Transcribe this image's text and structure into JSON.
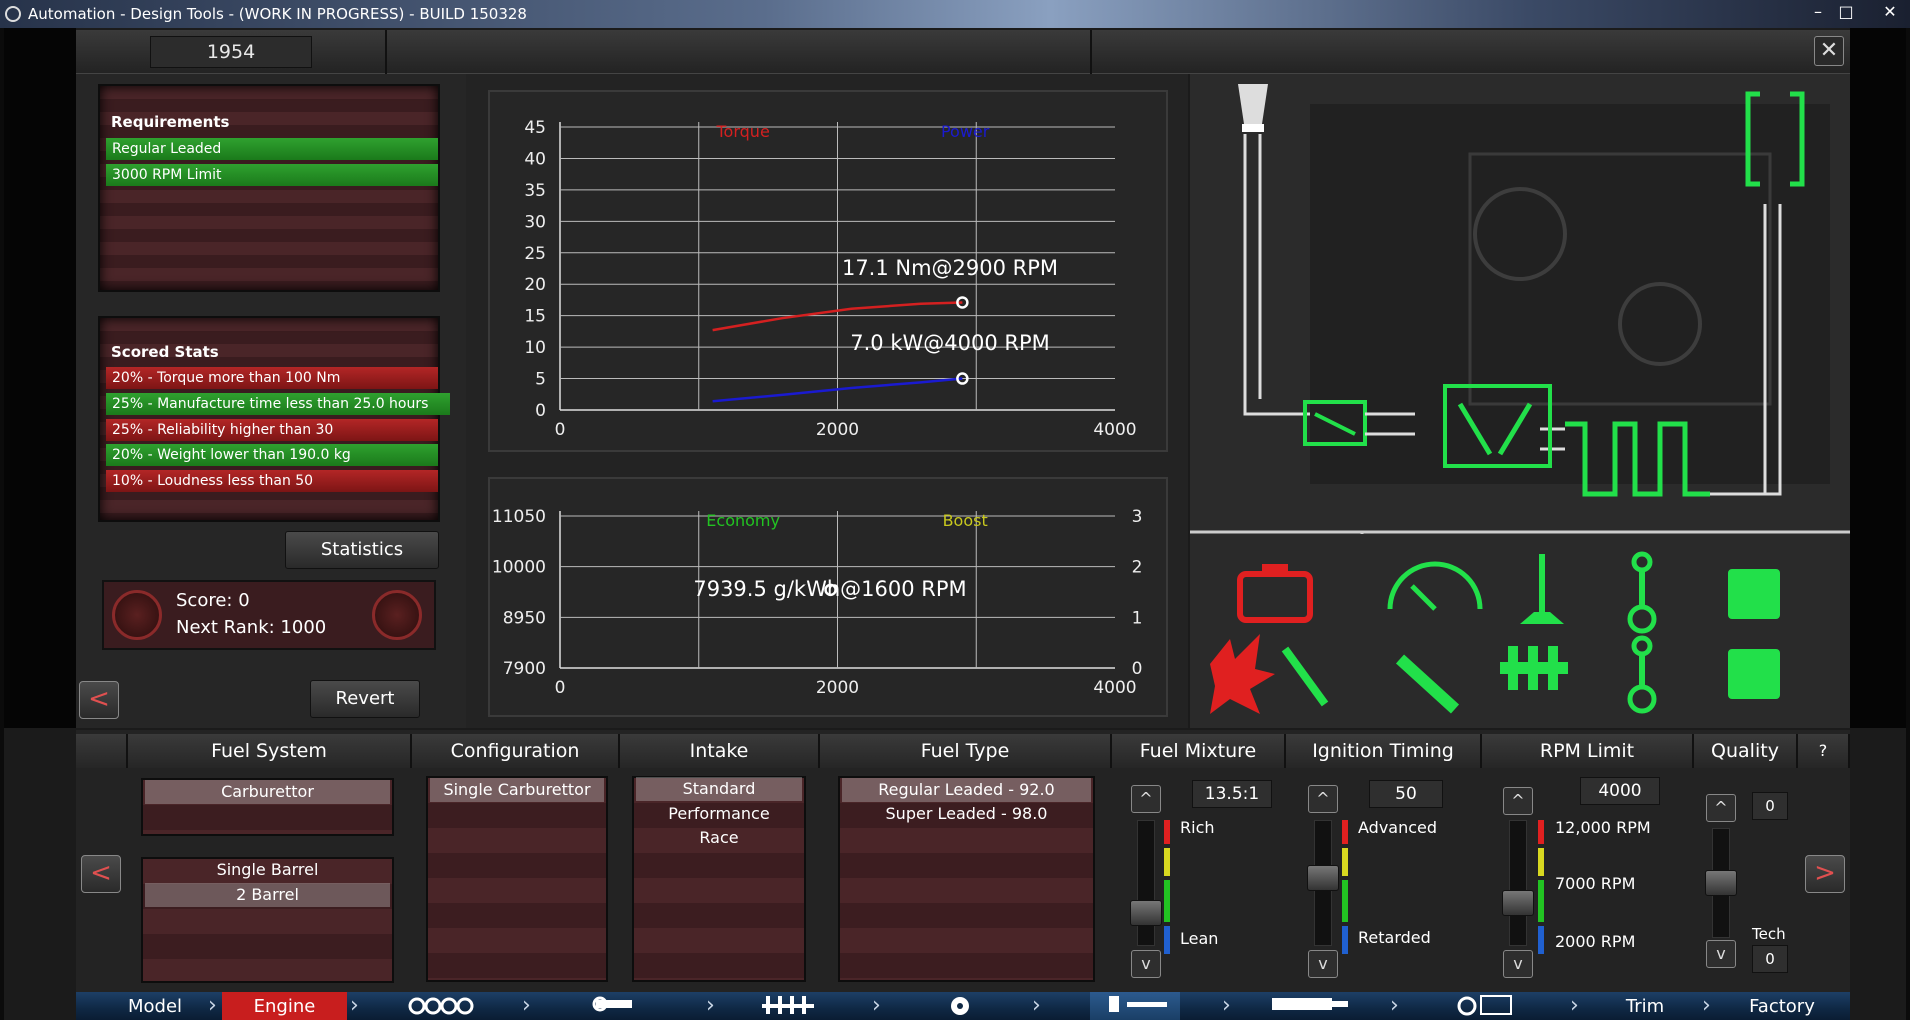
{
  "window": {
    "title": "Automation - Design Tools - (WORK IN PROGRESS) - BUILD 150328"
  },
  "header": {
    "year": "1954",
    "close_label": "✕"
  },
  "requirements": {
    "title": "Requirements",
    "items": [
      "Regular Leaded",
      "3000 RPM Limit"
    ]
  },
  "scored_stats": {
    "title": "Scored Stats",
    "items": [
      {
        "label": "20% - Torque more than 100 Nm",
        "status": "red"
      },
      {
        "label": "25% - Manufacture time less than 25.0 hours",
        "status": "green"
      },
      {
        "label": "25% - Reliability higher than 30",
        "status": "red"
      },
      {
        "label": "20% - Weight lower than 190.0 kg",
        "status": "green"
      },
      {
        "label": "10% - Loudness less than 50",
        "status": "red"
      }
    ]
  },
  "buttons": {
    "statistics": "Statistics",
    "revert": "Revert",
    "prev": "<",
    "next": ">"
  },
  "score": {
    "score_label": "Score: 0",
    "next_rank_label": "Next Rank: 1000"
  },
  "chart_data": [
    {
      "type": "line",
      "series": [
        {
          "name": "Torque",
          "color": "#d42020",
          "x": [
            1100,
            1600,
            2100,
            2600,
            2900
          ],
          "y": [
            12.7,
            14.6,
            16.1,
            16.9,
            17.1
          ]
        },
        {
          "name": "Power",
          "color": "#1a1ad0",
          "x": [
            1100,
            1600,
            2100,
            2600,
            2900
          ],
          "y": [
            1.4,
            2.4,
            3.5,
            4.4,
            5.0
          ]
        }
      ],
      "annotations": [
        "17.1 Nm@2900 RPM",
        "7.0 kW@4000 RPM"
      ],
      "xlim": [
        0,
        4000
      ],
      "ylim": [
        0,
        45
      ],
      "xticks": [
        "0",
        "2000",
        "4000"
      ],
      "yticks": [
        "0",
        "5",
        "10",
        "15",
        "20",
        "25",
        "30",
        "35",
        "40",
        "45"
      ],
      "grid": true,
      "legend": "top"
    },
    {
      "type": "line",
      "series": [
        {
          "name": "Economy",
          "color": "#22c322",
          "x": [
            1950
          ],
          "y": [
            9520
          ]
        },
        {
          "name": "Boost",
          "color": "#c8c81e",
          "x": [],
          "y": []
        }
      ],
      "annotations": [
        "7939.5 g/kWh@1600 RPM"
      ],
      "xlim": [
        0,
        4000
      ],
      "ylim": [
        7900,
        11050
      ],
      "y2lim": [
        0,
        3
      ],
      "xticks": [
        "0",
        "2000",
        "4000"
      ],
      "yticks": [
        "7900",
        "8950",
        "10000",
        "11050"
      ],
      "y2ticks": [
        "0",
        "1",
        "2",
        "3"
      ],
      "grid": true,
      "legend": "top"
    }
  ],
  "engine_icons": [
    "engine-warning-icon",
    "explosion-icon",
    "spark-plug-icon",
    "gauge-icon",
    "valve-icon",
    "conrod-icon",
    "piston-icon",
    "wrench-icon",
    "crankshaft-icon"
  ],
  "columns": {
    "fuel_system": "Fuel System",
    "configuration": "Configuration",
    "intake": "Intake",
    "fuel_type": "Fuel Type",
    "fuel_mixture": "Fuel Mixture",
    "ignition_timing": "Ignition Timing",
    "rpm_limit": "RPM Limit",
    "quality": "Quality",
    "help": "?"
  },
  "fuel_system": {
    "top": [
      "Carburettor"
    ],
    "bottom": [
      "Single Barrel",
      "2 Barrel"
    ]
  },
  "configuration": {
    "items": [
      "Single Carburettor"
    ]
  },
  "intake": {
    "items": [
      "Standard",
      "Performance",
      "Race"
    ]
  },
  "fuel_type": {
    "items": [
      "Regular Leaded - 92.0",
      "Super Leaded - 98.0"
    ]
  },
  "fuel_mixture": {
    "value": "13.5:1",
    "top_label": "Rich",
    "bottom_label": "Lean",
    "level": 0.2
  },
  "ignition_timing": {
    "value": "50",
    "top_label": "Advanced",
    "bottom_label": "Retarded",
    "level": 0.55
  },
  "rpm_limit": {
    "value": "4000",
    "top_label": "12,000 RPM",
    "mid_label": "7000 RPM",
    "bottom_label": "2000 RPM",
    "level": 0.3
  },
  "quality": {
    "value": "0",
    "tech_label": "Tech",
    "tech_value": "0",
    "level": 0.5
  },
  "spinner": {
    "up": "^",
    "down": "v"
  },
  "tabs": [
    "Model",
    "Engine",
    "Trim",
    "Factory"
  ],
  "colors": {
    "accent_green": "#22e04a",
    "accent_red": "#e02020",
    "tab_active": "#d42020"
  }
}
